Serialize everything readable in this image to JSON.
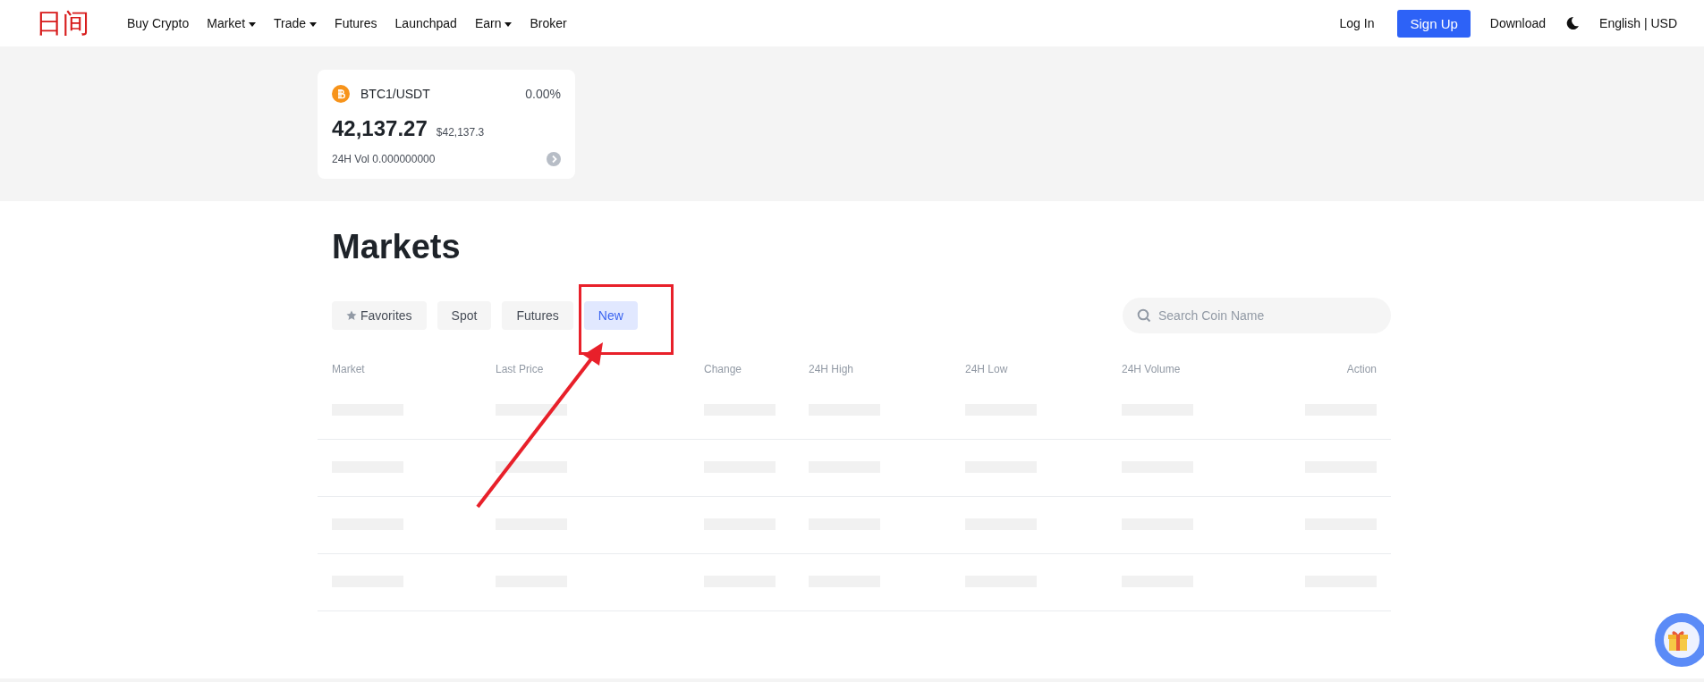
{
  "header": {
    "logo": "日间",
    "nav": [
      {
        "label": "Buy Crypto",
        "dropdown": false
      },
      {
        "label": "Market",
        "dropdown": true
      },
      {
        "label": "Trade",
        "dropdown": true
      },
      {
        "label": "Futures",
        "dropdown": false
      },
      {
        "label": "Launchpad",
        "dropdown": false
      },
      {
        "label": "Earn",
        "dropdown": true
      },
      {
        "label": "Broker",
        "dropdown": false
      }
    ],
    "login": "Log In",
    "signup": "Sign Up",
    "download": "Download",
    "locale": "English | USD"
  },
  "ticker_card": {
    "pair": "BTC1/USDT",
    "change": "0.00%",
    "price": "42,137.27",
    "price_usd": "$42,137.3",
    "volume": "24H Vol 0.000000000"
  },
  "markets": {
    "title": "Markets",
    "tabs": [
      {
        "label": "Favorites",
        "kind": "starred",
        "selected": false
      },
      {
        "label": "Spot",
        "kind": "plain",
        "selected": false
      },
      {
        "label": "Futures",
        "kind": "plain",
        "selected": false
      },
      {
        "label": "New",
        "kind": "plain",
        "selected": true
      }
    ],
    "search": {
      "placeholder": "Search Coin Name"
    },
    "table": {
      "columns": [
        "Market",
        "Last Price",
        "Change",
        "24H High",
        "24H Low",
        "24H Volume",
        "Action"
      ],
      "rows": [
        {
          "kind": "loading"
        },
        {
          "kind": "loading"
        },
        {
          "kind": "loading"
        },
        {
          "kind": "loading"
        }
      ]
    }
  }
}
